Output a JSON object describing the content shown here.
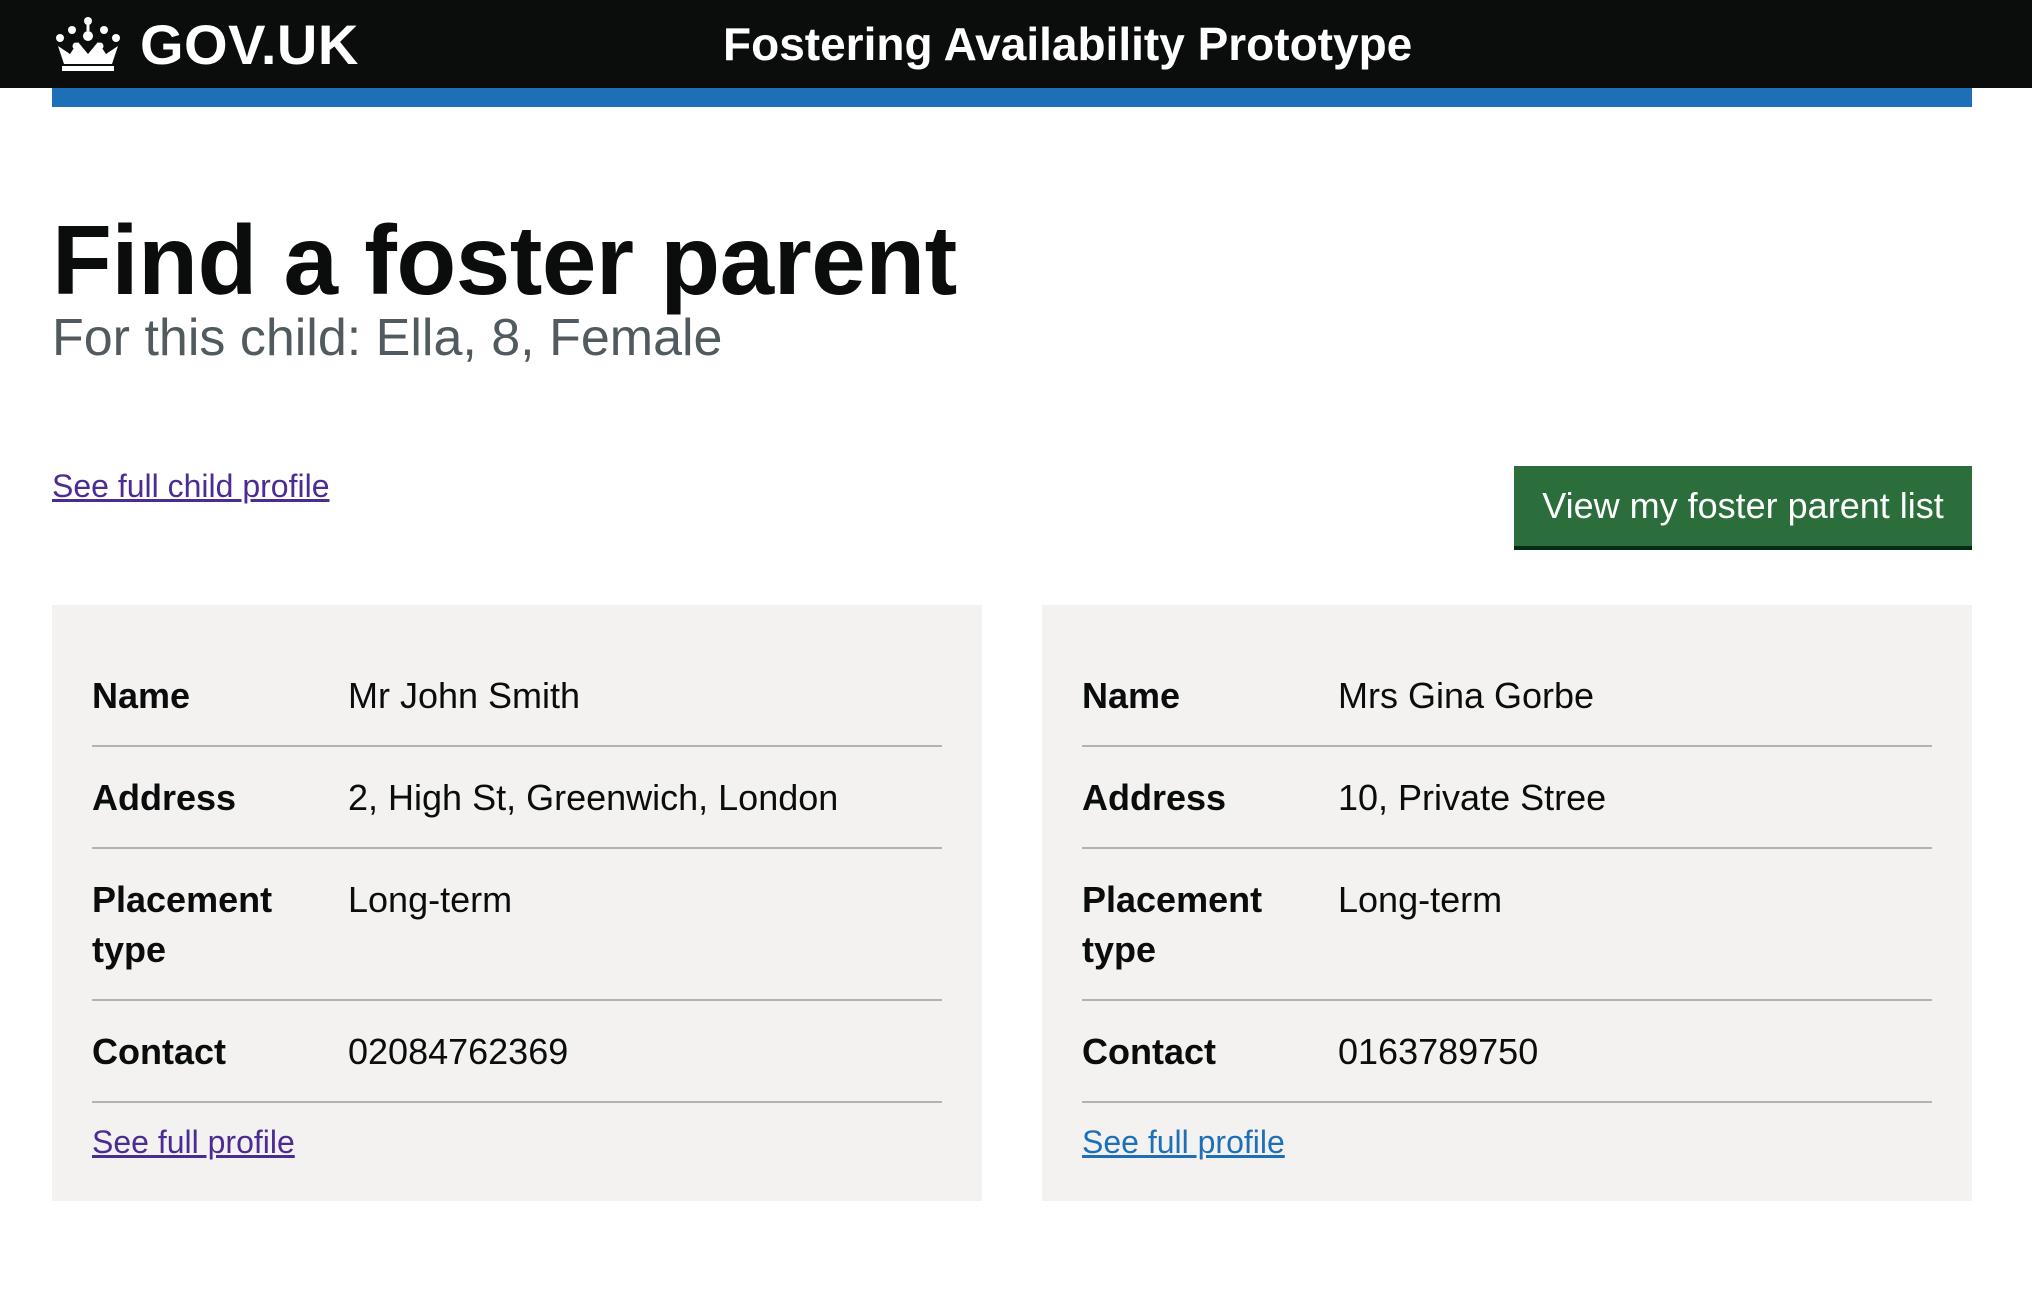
{
  "header": {
    "logo_text": "GOV.UK",
    "service_name": "Fostering Availability Prototype",
    "brand_color": "#0b0c0c",
    "accent_color": "#1d70b8"
  },
  "main": {
    "title": "Find a foster parent",
    "caption": "For this child: Ella, 8, Female",
    "child_profile_link": "See full child profile",
    "list_button": "View my foster parent list",
    "button_color": "#2b6e3b"
  },
  "cards": [
    {
      "rows": [
        {
          "key": "Name",
          "value": "Mr John Smith"
        },
        {
          "key": "Address",
          "value": "2, High St, Greenwich, London"
        },
        {
          "key": "Placement type",
          "value": "Long-term"
        },
        {
          "key": "Contact",
          "value": "02084762369"
        }
      ],
      "link": "See full profile",
      "link_color": "#4c2c92"
    },
    {
      "rows": [
        {
          "key": "Name",
          "value": "Mrs Gina Gorbe"
        },
        {
          "key": "Address",
          "value": "10, Private Stree"
        },
        {
          "key": "Placement type",
          "value": "Long-term"
        },
        {
          "key": "Contact",
          "value": "0163789750"
        }
      ],
      "link": "See full profile",
      "link_color": "#1d70b8"
    }
  ],
  "icons": {
    "logo": "crown-icon"
  }
}
